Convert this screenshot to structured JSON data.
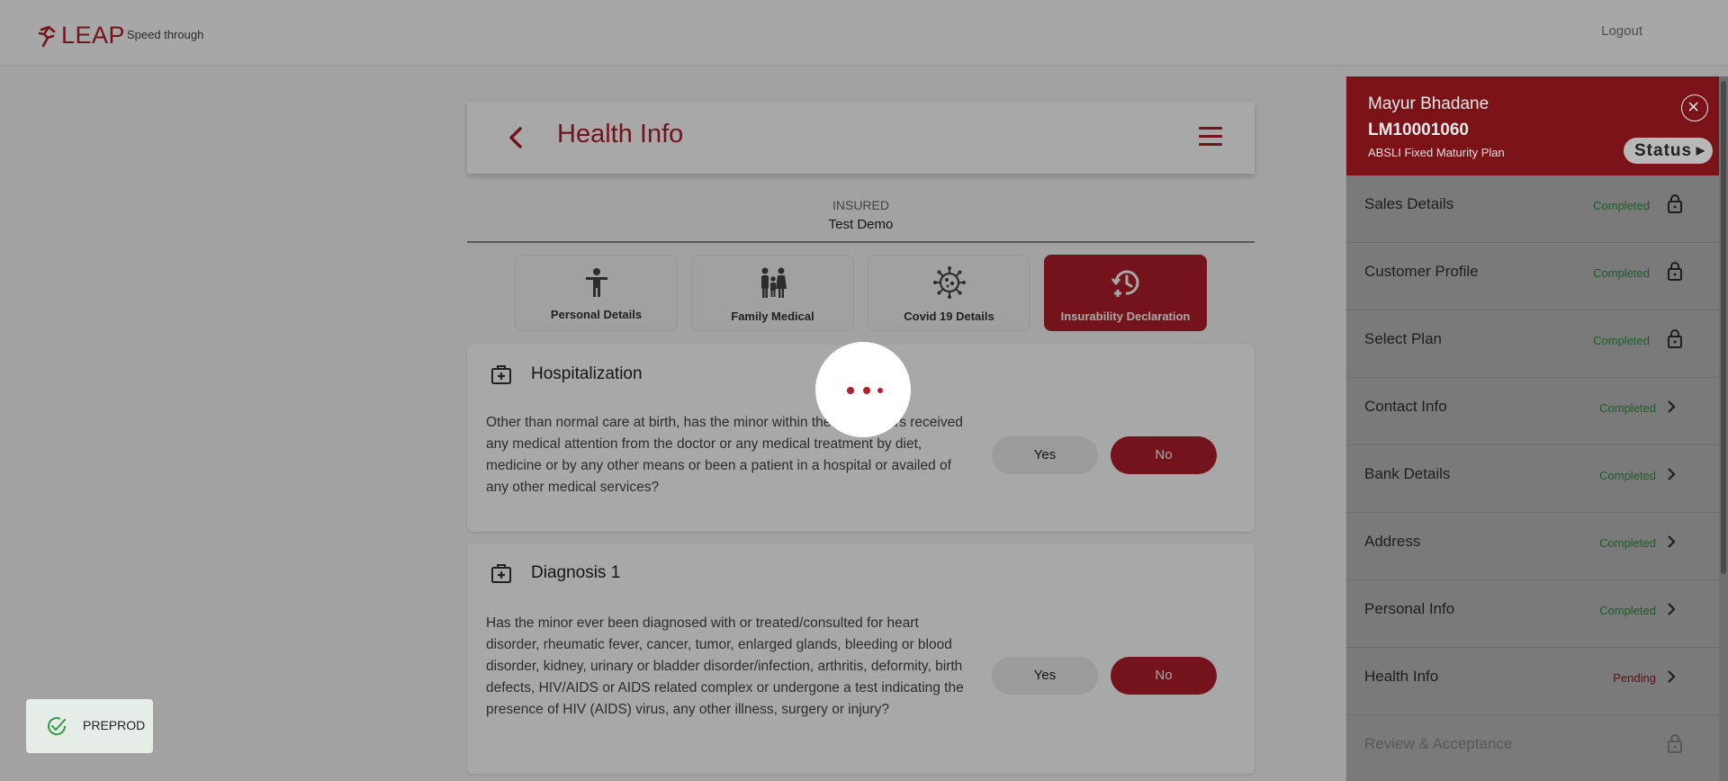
{
  "header": {
    "logo_text": "LEAP",
    "tagline": "Speed through",
    "logout_label": "Logout"
  },
  "page": {
    "title": "Health Info"
  },
  "insured": {
    "label": "INSURED",
    "name": "Test Demo"
  },
  "tabs": [
    {
      "label": "Personal Details",
      "icon": "person-icon",
      "active": false
    },
    {
      "label": "Family Medical",
      "icon": "family-icon",
      "active": false
    },
    {
      "label": "Covid 19 Details",
      "icon": "virus-icon",
      "active": false
    },
    {
      "label": "Insurability Declaration",
      "icon": "history-plus-icon",
      "active": true
    }
  ],
  "questions": [
    {
      "title": "Hospitalization",
      "text": "Other than normal care at birth, has the minor within the last 5 years received any medical attention from the doctor or any medical treatment by diet, medicine or by any other means or been a patient in a hospital or availed of any other medical services?",
      "yes_label": "Yes",
      "no_label": "No",
      "selected": "No"
    },
    {
      "title": "Diagnosis 1",
      "text": "Has the minor ever been diagnosed with or treated/consulted for heart disorder, rheumatic fever, cancer, tumor, enlarged glands, bleeding or blood disorder, kidney, urinary or bladder disorder/infection, arthritis, deformity, birth defects, HIV/AIDS or AIDS related complex or undergone a test indicating the presence of HIV (AIDS) virus, any other illness, surgery or injury?",
      "yes_label": "Yes",
      "no_label": "No",
      "selected": "No"
    }
  ],
  "side_panel": {
    "customer_name": "Mayur Bhadane",
    "application_id": "LM10001060",
    "plan_name": "ABSLI Fixed Maturity Plan",
    "status_label": "Status",
    "steps": [
      {
        "label": "Sales Details",
        "status": "Completed",
        "state": "locked-completed"
      },
      {
        "label": "Customer Profile",
        "status": "Completed",
        "state": "locked-completed"
      },
      {
        "label": "Select Plan",
        "status": "Completed",
        "state": "locked-completed"
      },
      {
        "label": "Contact Info",
        "status": "Completed",
        "state": "completed"
      },
      {
        "label": "Bank Details",
        "status": "Completed",
        "state": "completed"
      },
      {
        "label": "Address",
        "status": "Completed",
        "state": "completed"
      },
      {
        "label": "Personal Info",
        "status": "Completed",
        "state": "completed"
      },
      {
        "label": "Health Info",
        "status": "Pending",
        "state": "pending"
      },
      {
        "label": "Review & Acceptance",
        "status": "",
        "state": "locked"
      }
    ]
  },
  "toast": {
    "text": "PREPROD"
  },
  "colors": {
    "brand": "#b01e2a",
    "completed": "#2e9b47",
    "pending": "#8c1b24"
  }
}
